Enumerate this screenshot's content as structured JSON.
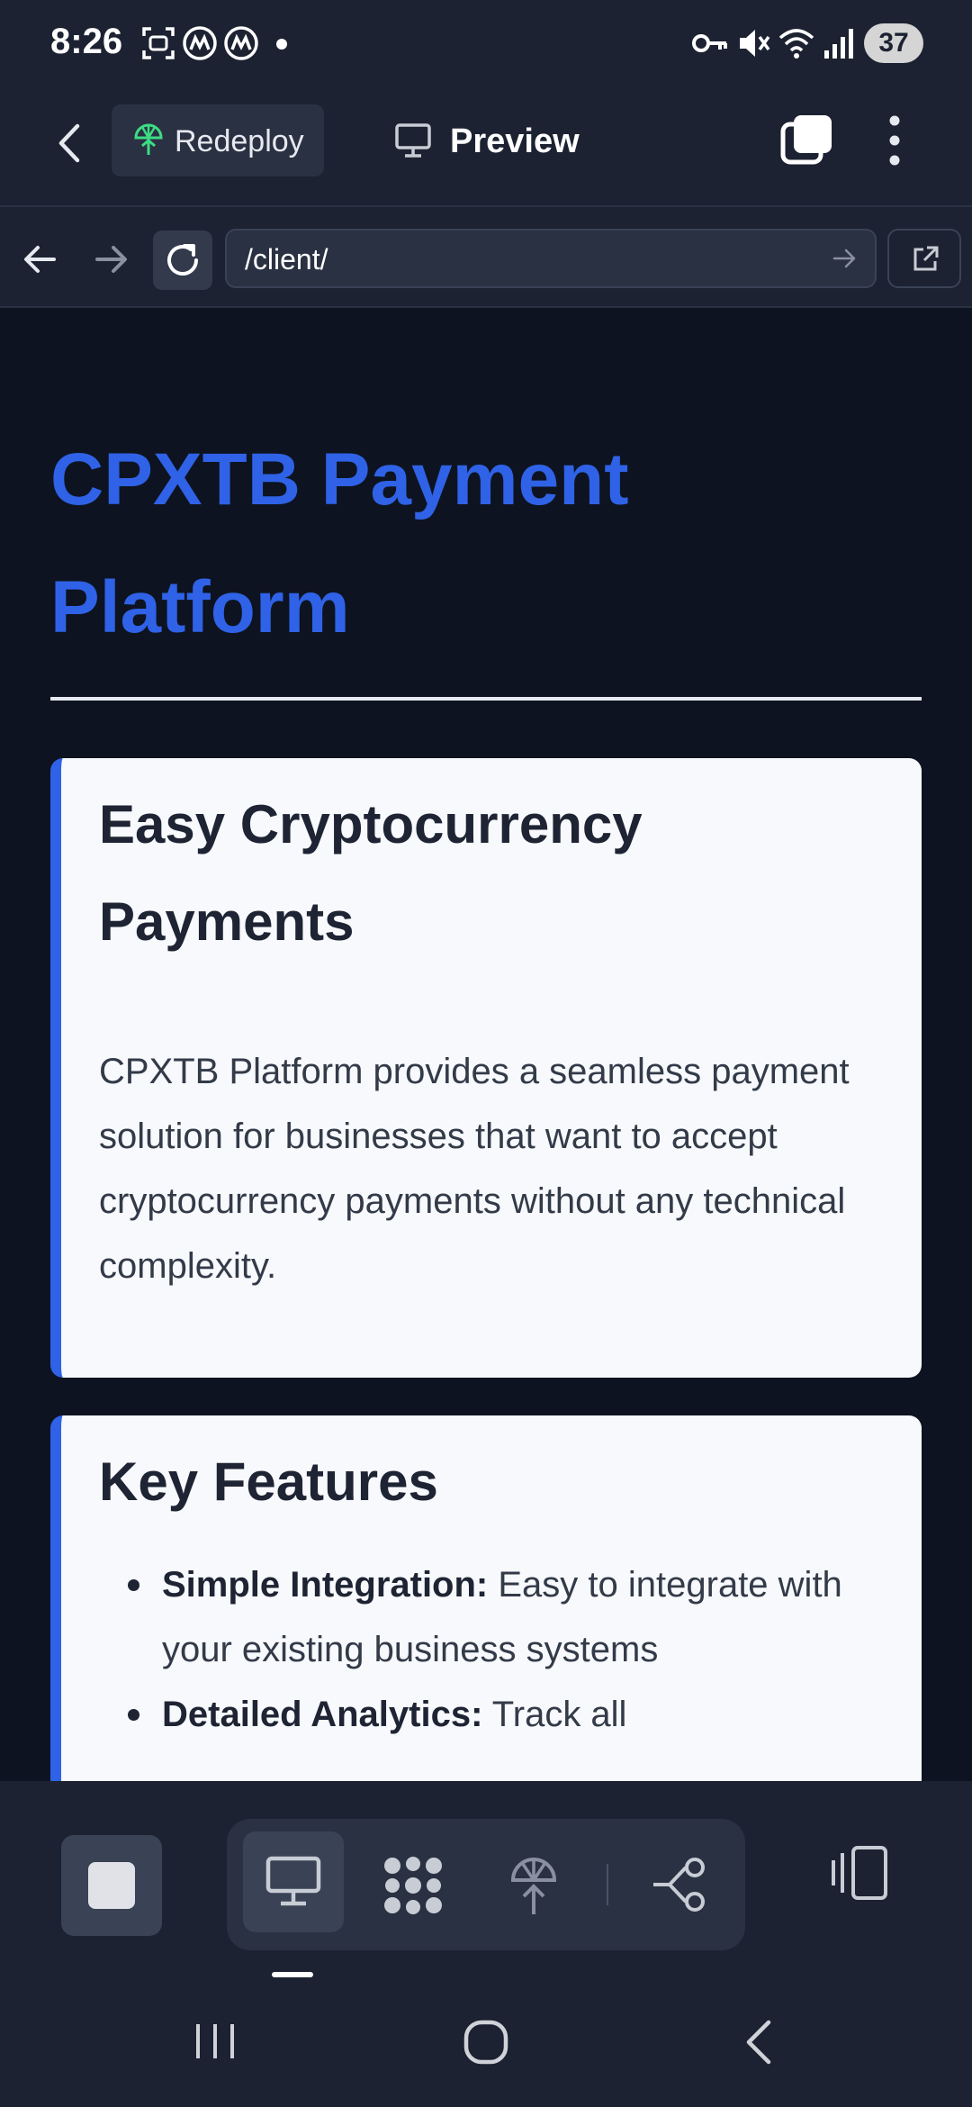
{
  "status_bar": {
    "time": "8:26",
    "battery": "37"
  },
  "app_header": {
    "redeploy_label": "Redeploy",
    "preview_label": "Preview"
  },
  "browser": {
    "url": "/client/"
  },
  "page": {
    "title_line1": "CPXTB Payment",
    "title_line2": "Platform",
    "cards": [
      {
        "heading_line1": "Easy Cryptocurrency",
        "heading_line2": "Payments",
        "body": "CPXTB Platform provides a seamless payment solution for businesses that want to accept cryptocurrency payments without any technical complexity."
      },
      {
        "heading": "Key Features",
        "features": [
          {
            "label": "Simple Integration:",
            "text": "Easy to integrate with your existing business systems"
          },
          {
            "label": "Detailed Analytics:",
            "text": "Track all"
          }
        ]
      }
    ]
  },
  "colors": {
    "accent": "#2f62e6",
    "background": "#0d1320",
    "chrome": "#1c2232",
    "card": "#f7f9fc"
  },
  "icons": {
    "status": [
      "screenshot-icon",
      "app-icon",
      "app-icon",
      "dot-icon",
      "key-icon",
      "mute-icon",
      "wifi-icon",
      "signal-icon"
    ],
    "toolbar": [
      "stop-icon",
      "desktop-icon",
      "apps-grid-icon",
      "deploy-icon",
      "branch-icon",
      "device-toggle-icon"
    ]
  }
}
